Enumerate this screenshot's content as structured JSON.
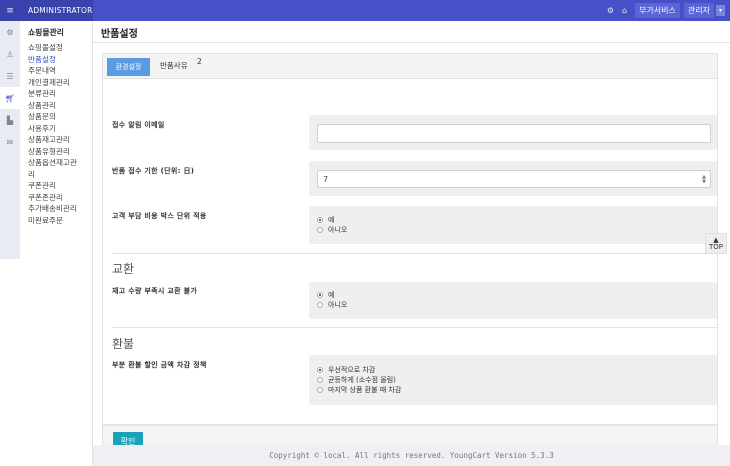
{
  "topbar": {
    "menu_glyph": "≡",
    "brand": "ADMINISTRATOR",
    "link_service": "부가서비스",
    "admin_label": "관리자",
    "caret": "▾",
    "accent_color": "#4650c8"
  },
  "iconbar": {
    "icons": [
      "gear-icon",
      "user-icon",
      "list-icon",
      "cart-icon",
      "chart-icon",
      "mail-icon"
    ]
  },
  "sidebar": {
    "group": "쇼핑몰관리",
    "items": [
      {
        "label": "쇼핑몰설정"
      },
      {
        "label": "반품설정",
        "current": true
      },
      {
        "label": "주문내역"
      },
      {
        "label": "개인결제관리"
      },
      {
        "label": "분류관리"
      },
      {
        "label": "상품관리"
      },
      {
        "label": "상품문의"
      },
      {
        "label": "사용후기"
      },
      {
        "label": "상품재고관리"
      },
      {
        "label": "상품유형관리"
      },
      {
        "label": "상품옵션재고관"
      },
      {
        "label": "리"
      },
      {
        "label": "쿠폰관리"
      },
      {
        "label": "쿠폰존관리"
      },
      {
        "label": "추가배송비관리"
      },
      {
        "label": "미완료주문"
      }
    ]
  },
  "page": {
    "title": "반품설정"
  },
  "tabs": {
    "active": "환경설정",
    "second": "반품사유",
    "second_count": "2"
  },
  "form": {
    "email_label": "접수 알림 이메일",
    "email_value": "",
    "deadline_label": "반품 접수 기한 (단위: 日)",
    "deadline_value": "7",
    "box_label": "고객 부담 비용 박스 단위 적용",
    "yes": "예",
    "no": "아니오",
    "exchange_heading": "교환",
    "stock_label": "재고 수량 부족시 교환 불가",
    "refund_heading": "환불",
    "partial_label": "부분 환불 할인 금액 차감 정책",
    "policy_opt1": "우선적으로 차감",
    "policy_opt2": "균등하게 (소수점 올림)",
    "policy_opt3": "마지막 상품 환불 때 차감",
    "confirm": "확인"
  },
  "top_button": {
    "arrow": "▲",
    "label": "TOP"
  },
  "footer": {
    "copyright": "Copyright © local. All rights reserved. YoungCart Version 5.3.3"
  }
}
